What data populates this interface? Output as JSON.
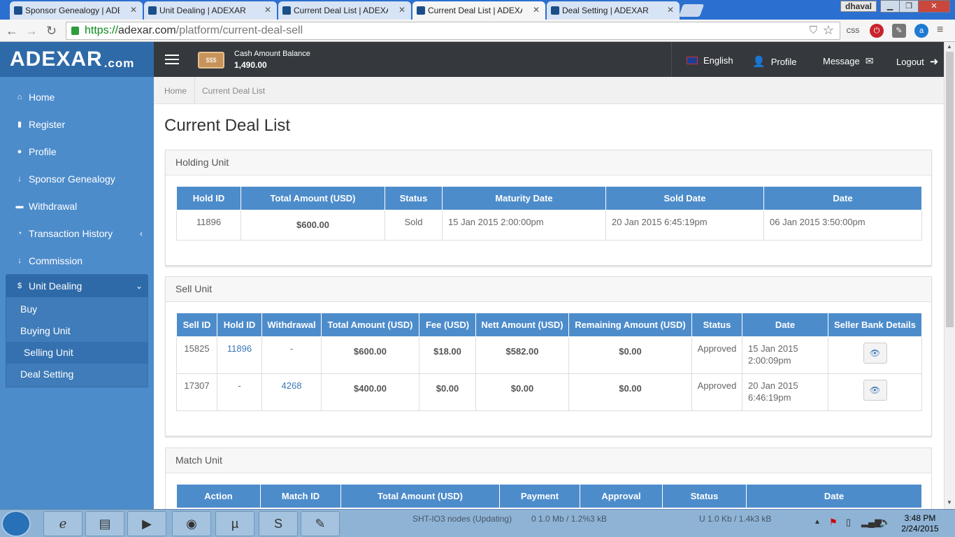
{
  "browser": {
    "tabs": [
      {
        "title": "Sponsor Genealogy | ADEXAR",
        "active": false
      },
      {
        "title": "Unit Dealing | ADEXAR",
        "active": false
      },
      {
        "title": "Current Deal List | ADEXAR",
        "active": false
      },
      {
        "title": "Current Deal List | ADEXAR",
        "active": true
      },
      {
        "title": "Deal Setting | ADEXAR",
        "active": false
      }
    ],
    "user": "dhaval",
    "url_scheme": "https://",
    "url_host": "adexar.com",
    "url_path": "/platform/current-deal-sell",
    "ext_css_label": "CSS"
  },
  "brand": {
    "name": "ADEXAR",
    "suffix": ".com"
  },
  "sidebar": {
    "items": [
      {
        "label": "Home",
        "icon": "home-icon",
        "glyph": "⌂"
      },
      {
        "label": "Register",
        "icon": "file-icon",
        "glyph": "▮"
      },
      {
        "label": "Profile",
        "icon": "user-icon",
        "glyph": "●"
      },
      {
        "label": "Sponsor Genealogy",
        "icon": "arrow-down-icon",
        "glyph": "↓"
      },
      {
        "label": "Withdrawal",
        "icon": "withdraw-icon",
        "glyph": "▬"
      },
      {
        "label": "Transaction History",
        "icon": "history-icon",
        "glyph": "◔",
        "caret": "‹"
      },
      {
        "label": "Commission",
        "icon": "arrow-down-icon",
        "glyph": "↓"
      }
    ],
    "open_item": {
      "label": "Unit Dealing",
      "icon": "dollar-icon",
      "glyph": "$",
      "caret": "⌄"
    },
    "submenu": [
      {
        "label": "Buy"
      },
      {
        "label": "Buying Unit"
      },
      {
        "label": "Selling Unit",
        "current": true
      },
      {
        "label": "Deal Setting"
      }
    ]
  },
  "topbar": {
    "cash_icon_text": "$$$",
    "cash_label": "Cash Amount Balance",
    "cash_value": "1,490.00",
    "language": "English",
    "profile": "Profile",
    "message": "Message",
    "logout": "Logout"
  },
  "breadcrumb": {
    "home": "Home",
    "current": "Current Deal List"
  },
  "page_title": "Current Deal List",
  "holding": {
    "title": "Holding Unit",
    "columns": [
      "Hold ID",
      "Total Amount (USD)",
      "Status",
      "Maturity Date",
      "Sold Date",
      "Date"
    ],
    "rows": [
      {
        "hold_id": "11896",
        "total": "$600.00",
        "status": "Sold",
        "maturity": "15 Jan 2015 2:00:00pm",
        "sold": "20 Jan 2015 6:45:19pm",
        "date": "06 Jan 2015 3:50:00pm"
      }
    ]
  },
  "sell": {
    "title": "Sell Unit",
    "columns": [
      "Sell ID",
      "Hold ID",
      "Withdrawal",
      "Total Amount (USD)",
      "Fee (USD)",
      "Nett Amount (USD)",
      "Remaining Amount (USD)",
      "Status",
      "Date",
      "Seller Bank Details"
    ],
    "rows": [
      {
        "sell_id": "15825",
        "hold_id": "11896",
        "withdrawal": "-",
        "total": "$600.00",
        "fee": "$18.00",
        "nett": "$582.00",
        "remaining": "$0.00",
        "status": "Approved",
        "date1": "15 Jan 2015",
        "date2": "2:00:09pm"
      },
      {
        "sell_id": "17307",
        "hold_id": "-",
        "withdrawal": "4268",
        "total": "$400.00",
        "fee": "$0.00",
        "nett": "$0.00",
        "remaining": "$0.00",
        "status": "Approved",
        "date1": "20 Jan 2015",
        "date2": "6:46:19pm"
      }
    ]
  },
  "match": {
    "title": "Match Unit",
    "columns": [
      "Action",
      "Match ID",
      "Total Amount (USD)",
      "Payment",
      "Approval",
      "Status",
      "Date"
    ]
  },
  "taskbar": {
    "time": "3:48 PM",
    "date": "2/24/2015",
    "tray_text_1": "SHT-IO3 nodes (Updating)",
    "tray_text_2": "0 1.0 Mb / 1.2%3 kB",
    "tray_text_3": "U 1.0 Kb / 1.4k3 kB"
  }
}
